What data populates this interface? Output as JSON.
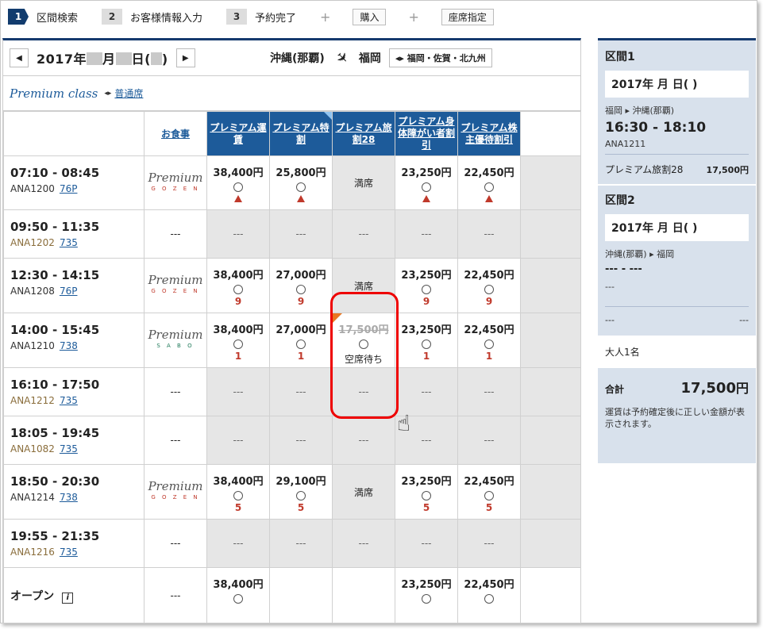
{
  "steps": [
    {
      "num": "1",
      "label": "区間検索"
    },
    {
      "num": "2",
      "label": "お客様情報入力"
    },
    {
      "num": "3",
      "label": "予約完了"
    }
  ],
  "plus": "+",
  "buy_label": "購入",
  "seat_label": "座席指定",
  "date": {
    "prefix": "2017年",
    "month": "月",
    "day": "日(",
    "close": ")"
  },
  "route": {
    "from": "沖縄(那覇)",
    "to": "福岡",
    "area": "福岡・佐賀・北九州"
  },
  "class": {
    "name": "Premium class",
    "other": "普通席"
  },
  "headers": {
    "meal": "お食事",
    "fares": [
      "プレミアム運賃",
      "プレミアム特割",
      "プレミアム旅割28",
      "プレミアム身体障がい者割引",
      "プレミアム株主優待割引"
    ]
  },
  "flights": [
    {
      "time": "07:10 - 08:45",
      "no": "ANA1200",
      "eq": "76P",
      "meal": "GOZEN",
      "prices": [
        "38,400円",
        "25,800円",
        "満席",
        "23,250円",
        "22,450円"
      ],
      "rem": [
        "▲",
        "▲",
        "",
        "▲",
        "▲"
      ]
    },
    {
      "time": "09:50 - 11:35",
      "no": "ANA1202",
      "eq": "735",
      "meal": "---",
      "prices": [
        "---",
        "---",
        "---",
        "---",
        "---"
      ]
    },
    {
      "time": "12:30 - 14:15",
      "no": "ANA1208",
      "eq": "76P",
      "meal": "GOZEN",
      "prices": [
        "38,400円",
        "27,000円",
        "満席",
        "23,250円",
        "22,450円"
      ],
      "rem": [
        "9",
        "9",
        "",
        "9",
        "9"
      ]
    },
    {
      "time": "14:00 - 15:45",
      "no": "ANA1210",
      "eq": "738",
      "meal": "SABO",
      "prices": [
        "38,400円",
        "27,000円",
        "17,500円",
        "23,250円",
        "22,450円"
      ],
      "rem": [
        "1",
        "1",
        "空席待ち",
        "1",
        "1"
      ]
    },
    {
      "time": "16:10 - 17:50",
      "no": "ANA1212",
      "eq": "735",
      "meal": "---",
      "prices": [
        "---",
        "---",
        "---",
        "---",
        "---"
      ]
    },
    {
      "time": "18:05 - 19:45",
      "no": "ANA1082",
      "eq": "735",
      "meal": "---",
      "prices": [
        "---",
        "---",
        "---",
        "---",
        "---"
      ]
    },
    {
      "time": "18:50 - 20:30",
      "no": "ANA1214",
      "eq": "738",
      "meal": "GOZEN",
      "prices": [
        "38,400円",
        "29,100円",
        "満席",
        "23,250円",
        "22,450円"
      ],
      "rem": [
        "5",
        "5",
        "",
        "5",
        "5"
      ]
    },
    {
      "time": "19:55 - 21:35",
      "no": "ANA1216",
      "eq": "735",
      "meal": "---",
      "prices": [
        "---",
        "---",
        "---",
        "---",
        "---"
      ]
    }
  ],
  "open": {
    "label": "オープン",
    "meal": "---",
    "prices": [
      "38,400円",
      "",
      "",
      "23,250円",
      "22,450円"
    ]
  },
  "meal_logo": {
    "word": "Premium",
    "gozen": "G O Z E N",
    "sabo": "S A B O"
  },
  "sidebar": {
    "seg1": {
      "title": "区間1",
      "date": "2017年 月 日( )",
      "route": "福岡 ▸ 沖縄(那覇)",
      "time": "16:30 - 18:10",
      "flight": "ANA1211",
      "fare": "プレミアム旅割28",
      "price": "17,500円"
    },
    "seg2": {
      "title": "区間2",
      "date": "2017年 月 日( )",
      "route": "沖縄(那覇) ▸ 福岡",
      "time": "--- - ---",
      "flight": "---",
      "left": "---",
      "right": "---"
    },
    "pax": "大人1名",
    "total_label": "合計",
    "total": "17,500",
    "yen": "円",
    "note": "運賃は予約確定後に正しい金額が表示されます。"
  }
}
